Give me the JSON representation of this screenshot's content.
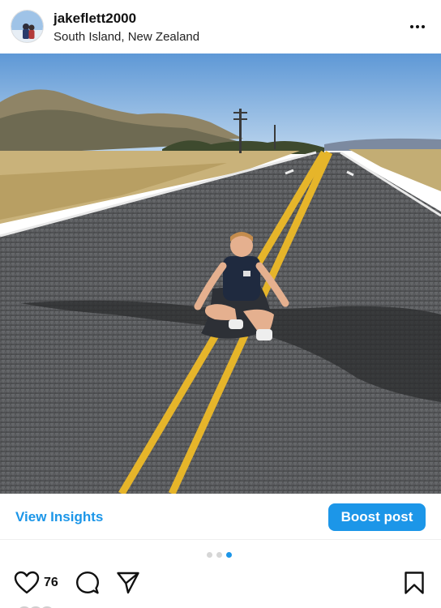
{
  "post": {
    "username": "jakeflett2000",
    "location": "South Island, New Zealand"
  },
  "insights": {
    "view_insights_label": "View Insights",
    "boost_label": "Boost post"
  },
  "carousel": {
    "count": 3,
    "active_index": 2
  },
  "actions": {
    "like_count": "76"
  },
  "icons": {
    "more": "more-horizontal-icon",
    "like": "heart-icon",
    "comment": "comment-icon",
    "share": "send-icon",
    "save": "bookmark-icon"
  },
  "colors": {
    "accent": "#1c96e8",
    "text": "#111111"
  }
}
